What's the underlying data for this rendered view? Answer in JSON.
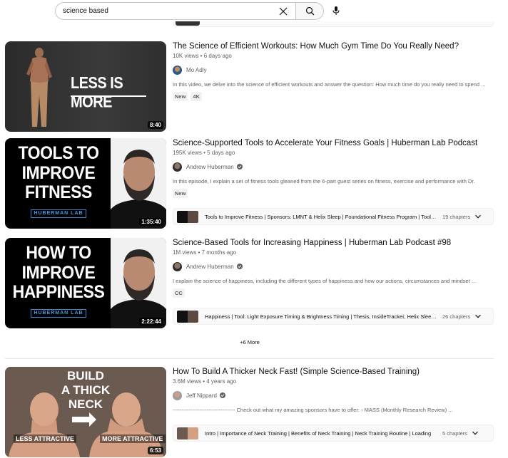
{
  "search": {
    "query": "science based"
  },
  "results": [
    {
      "title": "The Science of Efficient Workouts: How Much Gym Time Do You Really Need?",
      "meta": "10K views • 6 days ago",
      "channel": "Mo Adly",
      "verified": false,
      "description": "In this video, we delve into the science of efficient workouts and answer the question: How much time do you really need to spend ...",
      "badges": [
        "New",
        "4K"
      ],
      "duration": "8:40",
      "thumb_text": "LESS IS MORE"
    },
    {
      "title": "Science-Supported Tools to Accelerate Your Fitness Goals | Huberman Lab Podcast",
      "meta": "195K views • 5 days ago",
      "channel": "Andrew Huberman",
      "verified": true,
      "description": "In this episode, I explain a set of fitness tools gleaned from the 6-part guest series on fitness, exercise and performance with Dr.",
      "badges": [
        "New"
      ],
      "duration": "1:35:40",
      "thumb_text_lines": [
        "TOOLS TO",
        "IMPROVE",
        "FITNESS"
      ],
      "thumb_brand": "HUBERMAN LAB",
      "chapters_text": "Tools to Improve Fitness | Sponsors: LMNT & Helix Sleep | Foundational Fitness Program | Tool 1:...",
      "chapters_count": "19 chapters"
    },
    {
      "title": "Science-Based Tools for Increasing Happiness | Huberman Lab Podcast #98",
      "meta": "1M views • 7 months ago",
      "channel": "Andrew Huberman",
      "verified": true,
      "description": "I explain the science of happiness, including the different types of happiness and how our actions, circumstances and mindset ...",
      "badges": [
        "CC"
      ],
      "duration": "2:22:44",
      "thumb_text_lines": [
        "HOW TO",
        "IMPROVE",
        "HAPPINESS"
      ],
      "thumb_brand": "HUBERMAN LAB",
      "chapters_text": "Happiness | Tool: Light Exposure Timing & Brightness Timing | Thesis, InsideTracker, Helix Sleep |...",
      "chapters_count": "26 chapters"
    },
    {
      "title": "How To Build A Thicker Neck Fast! (Simple Science-Based Training)",
      "meta": "3.6M views • 4 years ago",
      "channel": "Jeff Nippard",
      "verified": true,
      "description": "----------------------------------- Check out what my amazing sponsors have to offer: › MASS (Monthly Research Review) ...",
      "badges": [],
      "duration": "6:53",
      "thumb_text_lines": [
        "BUILD",
        "A THICK",
        "NECK"
      ],
      "thumb_left_label": "LESS ATTRACTIVE",
      "thumb_right_label": "MORE ATTRACTIVE",
      "chapters_text": "Intro | Importance of Neck Training | Benefits of Neck Training | Neck Training Routine | Loading",
      "chapters_count": "5 chapters"
    }
  ],
  "more_label": "+6 More"
}
